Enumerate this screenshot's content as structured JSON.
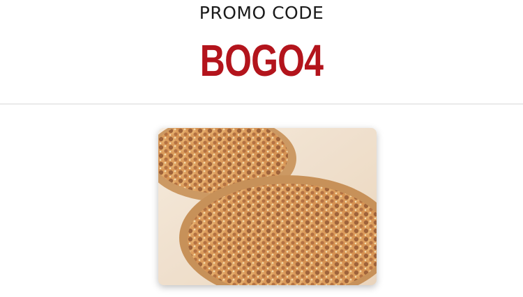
{
  "promo": {
    "label": "PROMO CODE",
    "code": "BOGO4"
  },
  "colors": {
    "code_red": "#b3141c",
    "label_text": "#1a1a1a",
    "divider": "#d7d7d7"
  },
  "image": {
    "icon": "pizza-photo"
  }
}
